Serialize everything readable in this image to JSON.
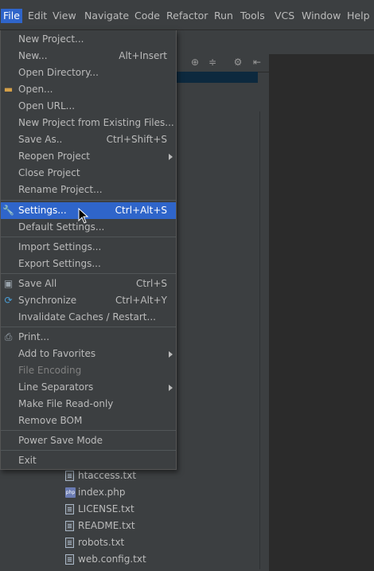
{
  "menubar": {
    "items": [
      "File",
      "Edit",
      "View",
      "Navigate",
      "Code",
      "Refactor",
      "Run",
      "Tools",
      "VCS",
      "Window",
      "Help"
    ],
    "active": "File"
  },
  "file_menu": {
    "new_project": "New Project...",
    "new": "New...",
    "new_sc": "Alt+Insert",
    "open_directory": "Open Directory...",
    "open": "Open...",
    "open_url": "Open URL...",
    "new_from_existing": "New Project from Existing Files...",
    "save_as": "Save As..",
    "save_as_sc": "Ctrl+Shift+S",
    "reopen_project": "Reopen Project",
    "close_project": "Close Project",
    "rename_project": "Rename Project...",
    "settings": "Settings...",
    "settings_sc": "Ctrl+Alt+S",
    "default_settings": "Default Settings...",
    "import_settings": "Import Settings...",
    "export_settings": "Export Settings...",
    "save_all": "Save All",
    "save_all_sc": "Ctrl+S",
    "synchronize": "Synchronize",
    "synchronize_sc": "Ctrl+Alt+Y",
    "invalidate_caches": "Invalidate Caches / Restart...",
    "print": "Print...",
    "add_to_favorites": "Add to Favorites",
    "file_encoding": "File Encoding",
    "line_separators": "Line Separators",
    "make_read_only": "Make File Read-only",
    "remove_bom": "Remove BOM",
    "power_save_mode": "Power Save Mode",
    "exit": "Exit"
  },
  "project_files": [
    "htaccess.txt",
    "index.php",
    "LICENSE.txt",
    "README.txt",
    "robots.txt",
    "web.config.txt"
  ],
  "icons": {
    "php_badge": "php"
  },
  "colors": {
    "menu_bg": "#3c3f41",
    "selection": "#2f65ca",
    "editor_bg": "#2b2b2b",
    "text": "#bbbbbb",
    "disabled_text": "#808080"
  }
}
